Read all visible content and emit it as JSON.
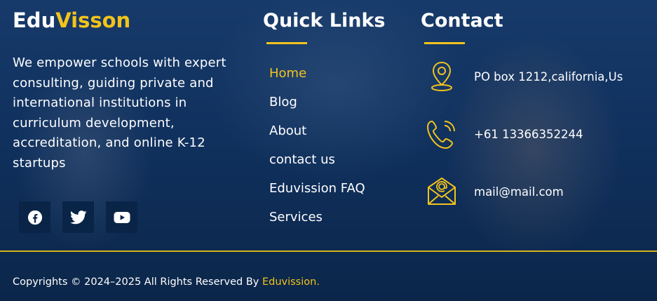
{
  "brand": {
    "part1": "Edu",
    "part2": "Visson"
  },
  "about": {
    "text": "We empower schools with expert consulting, guiding private and international institutions in curriculum development, accreditation, and online K-12 startups"
  },
  "socials": [
    {
      "icon": "facebook-icon"
    },
    {
      "icon": "twitter-icon"
    },
    {
      "icon": "youtube-icon"
    }
  ],
  "quick_links": {
    "heading": "Quick Links",
    "items": [
      {
        "label": "Home",
        "active": true
      },
      {
        "label": "Blog"
      },
      {
        "label": "About"
      },
      {
        "label": "contact us"
      },
      {
        "label": "Eduvission FAQ"
      },
      {
        "label": "Services"
      }
    ]
  },
  "contact": {
    "heading": "Contact",
    "address": "PO box 1212,california,Us",
    "phone": "+61 13366352244",
    "email": "mail@mail.com"
  },
  "footer": {
    "copyright": "Copyrights © 2024–2025 All Rights Reserved By ",
    "brand": "Eduvission."
  },
  "colors": {
    "accent": "#f3c31b",
    "background": "#0f2c55",
    "social_bg": "#0a2447"
  }
}
